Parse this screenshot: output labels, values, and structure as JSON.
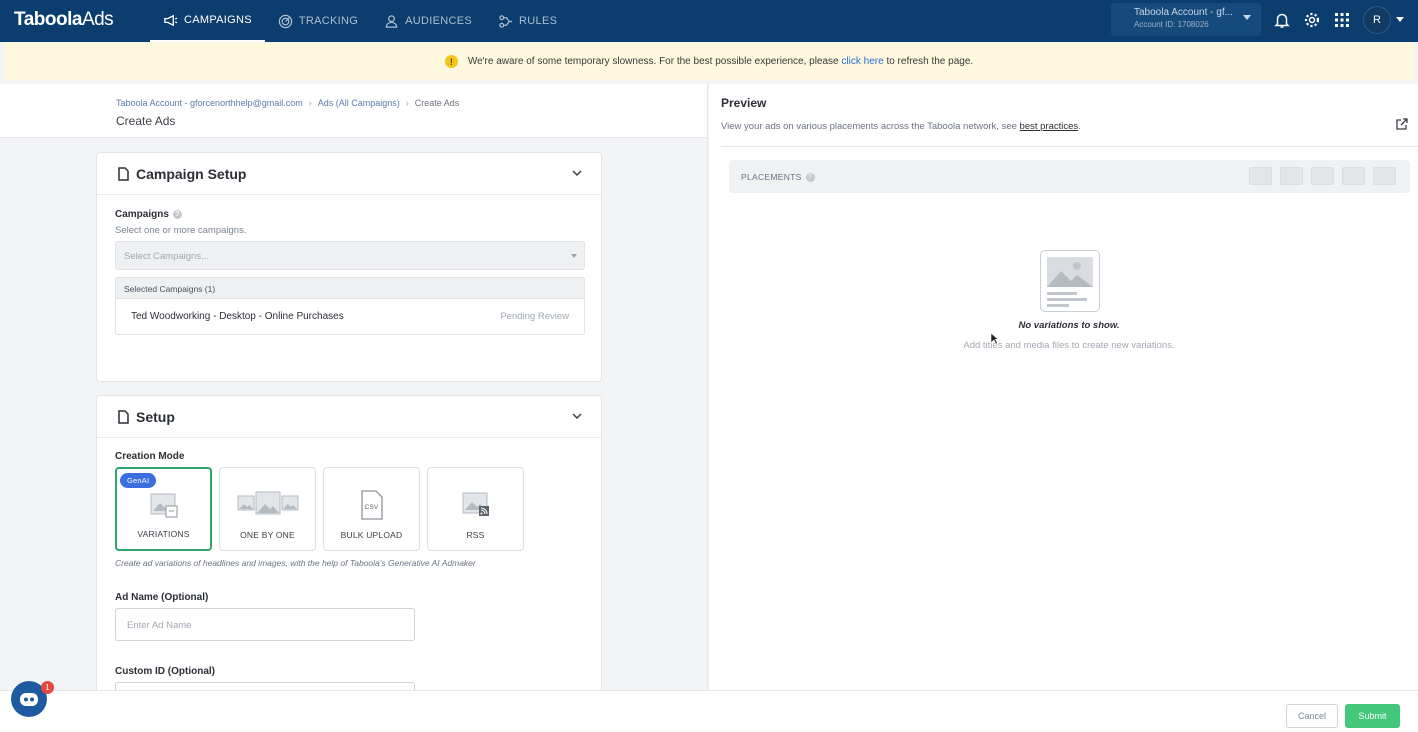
{
  "brand": {
    "logo_main": "Taboola",
    "logo_sub": "Ads"
  },
  "nav": {
    "items": [
      {
        "label": "CAMPAIGNS",
        "icon": "megaphone-icon",
        "active": true
      },
      {
        "label": "TRACKING",
        "icon": "tracking-icon",
        "active": false
      },
      {
        "label": "AUDIENCES",
        "icon": "person-icon",
        "active": false
      },
      {
        "label": "RULES",
        "icon": "rules-icon",
        "active": false
      }
    ],
    "account_name": "Taboola Account - gf...",
    "account_id": "Account ID: 1708026",
    "avatar_initial": "R"
  },
  "banner": {
    "text_before": "We're aware of some temporary slowness. For the best possible experience, please",
    "link": "click here",
    "text_after": "to refresh the page."
  },
  "breadcrumb": {
    "items": [
      "Taboola Account - gforcenorthhelp@gmail.com",
      "Ads (All Campaigns)",
      "Create Ads"
    ],
    "title": "Create Ads"
  },
  "campaign_setup": {
    "title": "Campaign Setup",
    "campaigns_label": "Campaigns",
    "campaigns_hint": "Select one or more campaigns.",
    "select_placeholder": "Select Campaigns...",
    "selected_header": "Selected Campaigns (1)",
    "selected": [
      {
        "name": "Ted Woodworking -  Desktop - Online Purchases",
        "status": "Pending Review"
      }
    ]
  },
  "setup": {
    "title": "Setup",
    "creation_mode_label": "Creation Mode",
    "modes": [
      {
        "label": "VARIATIONS",
        "badge": "GenAI",
        "active": true
      },
      {
        "label": "ONE BY ONE",
        "active": false
      },
      {
        "label": "BULK UPLOAD",
        "active": false
      },
      {
        "label": "RSS",
        "active": false
      }
    ],
    "mode_hint": "Create ad variations of headlines and images, with the help of Taboola's Generative AI Admaker",
    "ad_name_label": "Ad Name (Optional)",
    "ad_name_placeholder": "Enter Ad Name",
    "custom_id_label": "Custom ID (Optional)"
  },
  "preview": {
    "title": "Preview",
    "subtitle": "View your ads on various placements across the Taboola network, see",
    "subtitle_link": "best practices",
    "subtitle_end": ".",
    "placements_label": "PLACEMENTS",
    "empty_title": "No variations to show.",
    "empty_hint": "Add titles and media files to create new variations."
  },
  "footer": {
    "cancel_label": "Cancel",
    "submit_label": "Submit"
  },
  "chat": {
    "badge_count": "1"
  },
  "colors": {
    "nav_bg": "#0b3d6e",
    "accent_green": "#43c77a",
    "genai_blue": "#3b6fe0",
    "banner_bg": "#fdf8de"
  }
}
